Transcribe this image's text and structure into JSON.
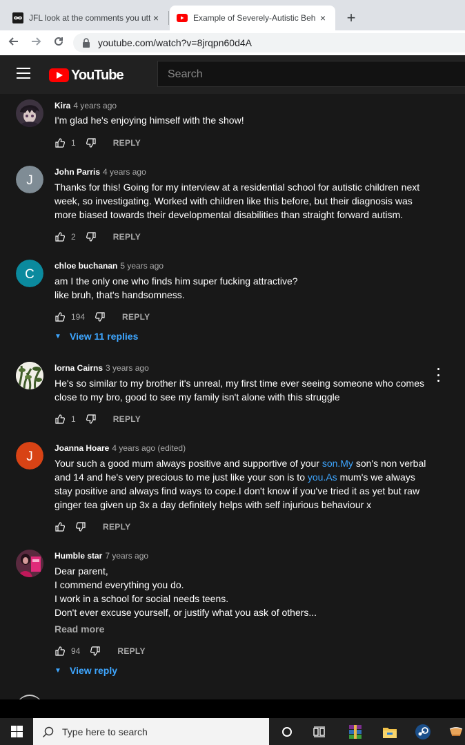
{
  "browser": {
    "tabs": [
      {
        "title": "JFL look at the comments you utt",
        "favicon": "jfl-infinity-icon",
        "active": false
      },
      {
        "title": "Example of Severely-Autistic Beh",
        "favicon": "youtube-icon",
        "active": true
      }
    ],
    "close_glyph": "×",
    "new_tab_glyph": "+",
    "url": "youtube.com/watch?v=8jrqpn60d4A"
  },
  "youtube": {
    "logo_text": "YouTube",
    "search_placeholder": "Search"
  },
  "comments": [
    {
      "author": "Kira",
      "time": "4 years ago",
      "avatar": {
        "type": "image",
        "bg": "#4a3f4d",
        "icon": "anime-avatar-icon"
      },
      "text": "I'm glad he's enjoying himself with the show!",
      "likes": "1",
      "reply_label": "REPLY"
    },
    {
      "author": "John Parris",
      "time": "4 years ago",
      "avatar": {
        "type": "letter",
        "letter": "J",
        "bg": "#7f8c95"
      },
      "text": "Thanks for this! Going for my interview at a residential school for autistic children next week, so investigating. Worked with children like this before, but their diagnosis was more biased towards their developmental disabilities than straight forward autism.",
      "likes": "2",
      "reply_label": "REPLY"
    },
    {
      "author": "chloe buchanan",
      "time": "5 years ago",
      "avatar": {
        "type": "letter",
        "letter": "C",
        "bg": "#0b8a9e"
      },
      "text": "am I the only one who finds him super fucking attractive?\nlike bruh, that's handsomness.",
      "likes": "194",
      "reply_label": "REPLY",
      "view_replies": "View 11 replies"
    },
    {
      "author": "lorna Cairns",
      "time": "3 years ago",
      "avatar": {
        "type": "image",
        "bg": "#2e3a28",
        "icon": "plant-avatar-icon"
      },
      "text": "He's so similar to my brother it's unreal, my first time ever seeing someone who comes close to my bro, good to see my family isn't alone with this struggle",
      "likes": "1",
      "reply_label": "REPLY"
    },
    {
      "author": "Joanna Hoare",
      "time": "4 years ago (edited)",
      "avatar": {
        "type": "letter",
        "letter": "J",
        "bg": "#d84315"
      },
      "text_parts": [
        {
          "t": "Your such a good mum always positive and supportive of your "
        },
        {
          "t": "son.My",
          "link": true
        },
        {
          "t": " son's non verbal and 14 and he's very precious to me just like your son is to "
        },
        {
          "t": "you.As",
          "link": true
        },
        {
          "t": " mum's we always stay positive and always find ways to cope.I don't know if you've tried it as yet but raw ginger tea given up 3x a day definitely helps with self injurious behaviour  x"
        }
      ],
      "likes": "",
      "reply_label": "REPLY"
    },
    {
      "author": "Humble star",
      "time": "7 years ago",
      "avatar": {
        "type": "image",
        "bg": "#5a1f3a",
        "icon": "person-avatar-icon"
      },
      "text": "Dear parent,\nI commend everything you do.\nI work in a school for social needs teens.\nDon't ever excuse yourself, or justify what you ask of others...",
      "read_more": "Read more",
      "likes": "94",
      "reply_label": "REPLY",
      "view_replies": "View reply"
    }
  ],
  "taskbar": {
    "search_placeholder": "Type here to search",
    "icons": [
      "cortana-icon",
      "task-view-icon",
      "winrar-icon",
      "file-explorer-icon",
      "steam-icon",
      "app-icon"
    ]
  }
}
